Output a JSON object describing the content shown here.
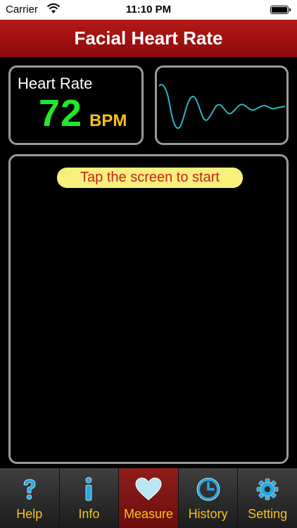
{
  "status": {
    "carrier": "Carrier",
    "time": "11:10 PM"
  },
  "title": "Facial Heart Rate",
  "heart_rate": {
    "label": "Heart Rate",
    "value": "72",
    "unit": "BPM"
  },
  "banner": "Tap the screen to start",
  "tabs": [
    {
      "label": "Help",
      "icon": "question-icon"
    },
    {
      "label": "Info",
      "icon": "info-icon"
    },
    {
      "label": "Measure",
      "icon": "heart-icon",
      "active": true
    },
    {
      "label": "History",
      "icon": "clock-icon"
    },
    {
      "label": "Setting",
      "icon": "gear-icon"
    }
  ],
  "colors": {
    "title_bar": "#a3120f",
    "bpm_value": "#21e82a",
    "bpm_unit": "#f5c218",
    "wave": "#2bb6c4",
    "tab_label": "#f6c21c",
    "banner_bg": "#f7f07a",
    "banner_text": "#c42323"
  }
}
